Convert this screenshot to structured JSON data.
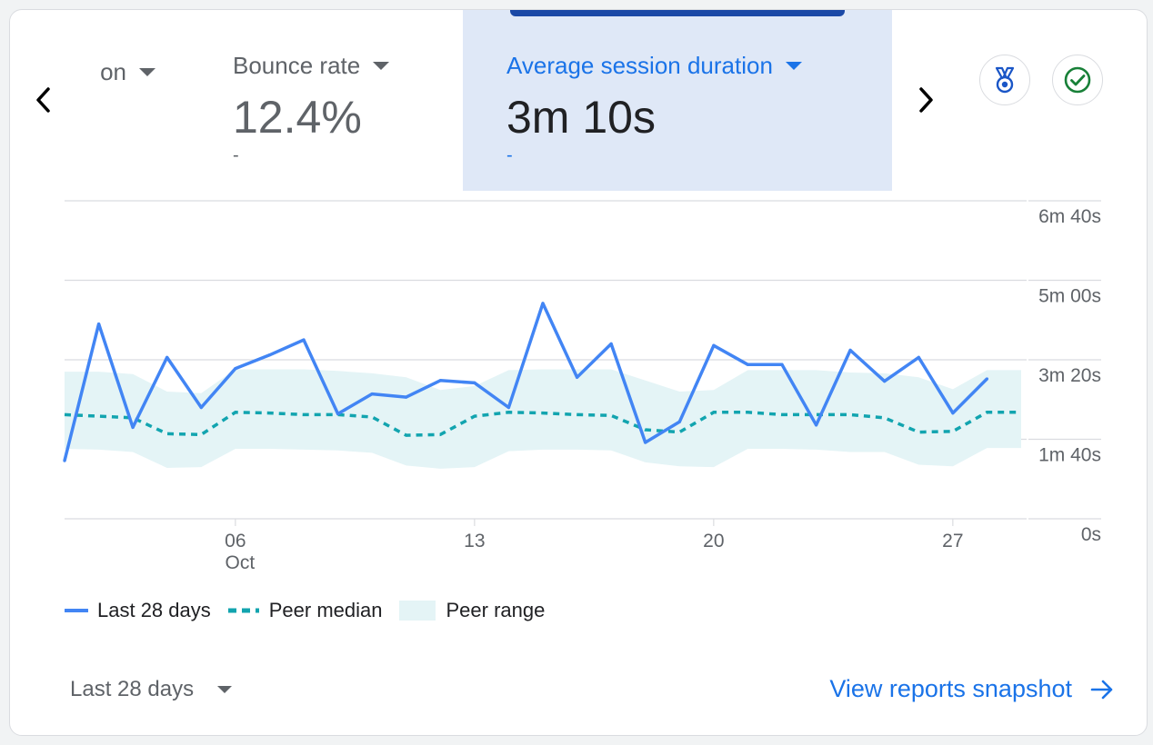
{
  "metrics": [
    {
      "title": "on",
      "value": "",
      "delta": ""
    },
    {
      "title": "Bounce rate",
      "value": "12.4%",
      "delta": "-"
    },
    {
      "title": "Average session duration",
      "value": "3m 10s",
      "delta": "-"
    }
  ],
  "icons": {
    "prev": "chevron-left-icon",
    "next": "chevron-right-icon",
    "badge": "medal-icon",
    "check": "check-circle-icon",
    "arrow": "arrow-right-icon"
  },
  "colors": {
    "accent": "#1a73e8",
    "line": "#4285f4",
    "median": "#12a4af",
    "range": "#e4f4f6",
    "active_bg": "#dfe8f7",
    "check": "#188038"
  },
  "chart_data": {
    "type": "line",
    "y_unit": "seconds",
    "ylim": [
      0,
      400
    ],
    "y_ticks": [
      {
        "value": 400,
        "label": "6m 40s"
      },
      {
        "value": 300,
        "label": "5m 00s"
      },
      {
        "value": 200,
        "label": "3m 20s"
      },
      {
        "value": 100,
        "label": "1m 40s"
      },
      {
        "value": 0,
        "label": "0s"
      }
    ],
    "x_ticks": [
      {
        "day": 6,
        "label": "06",
        "sub": "Oct"
      },
      {
        "day": 13,
        "label": "13",
        "sub": ""
      },
      {
        "day": 20,
        "label": "20",
        "sub": ""
      },
      {
        "day": 27,
        "label": "27",
        "sub": ""
      }
    ],
    "x_days": [
      1,
      2,
      3,
      4,
      5,
      6,
      7,
      8,
      9,
      10,
      11,
      12,
      13,
      14,
      15,
      16,
      17,
      18,
      19,
      20,
      21,
      22,
      23,
      24,
      25,
      26,
      27,
      28,
      29
    ],
    "series": [
      {
        "name": "Last 28 days",
        "values": [
          73,
          245,
          115,
          203,
          140,
          189,
          206,
          225,
          132,
          157,
          153,
          174,
          171,
          140,
          271,
          178,
          220,
          96,
          122,
          218,
          194,
          194,
          118,
          212,
          173,
          203,
          133,
          176
        ]
      },
      {
        "name": "Peer median",
        "values": [
          131,
          129,
          127,
          107,
          106,
          134,
          133,
          131,
          131,
          128,
          105,
          106,
          129,
          134,
          133,
          131,
          130,
          112,
          109,
          134,
          134,
          131,
          131,
          131,
          127,
          109,
          110,
          134,
          134
        ]
      },
      {
        "name": "Peer range",
        "upper": [
          185,
          185,
          182,
          160,
          158,
          188,
          188,
          188,
          186,
          183,
          178,
          162,
          167,
          187,
          188,
          188,
          188,
          174,
          160,
          162,
          187,
          187,
          187,
          184,
          183,
          178,
          163,
          187,
          187
        ],
        "lower": [
          88,
          87,
          84,
          64,
          65,
          88,
          88,
          87,
          86,
          83,
          67,
          63,
          65,
          85,
          87,
          87,
          86,
          71,
          66,
          65,
          88,
          88,
          87,
          84,
          84,
          68,
          66,
          89,
          89
        ]
      }
    ],
    "legend": [
      "Last 28 days",
      "Peer median",
      "Peer range"
    ],
    "grid": true
  },
  "footer": {
    "range_label": "Last 28 days",
    "link_label": "View reports snapshot"
  }
}
